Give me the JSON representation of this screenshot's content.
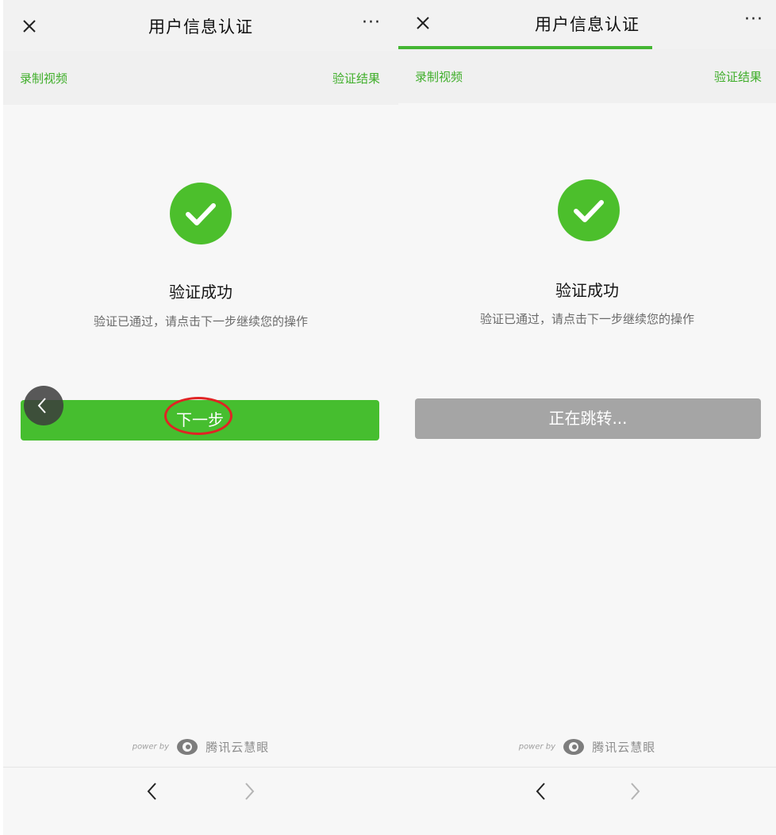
{
  "left": {
    "title": "用户信息认证",
    "more_label": "···",
    "tab_record": "录制视频",
    "tab_result": "验证结果",
    "success_title": "验证成功",
    "success_desc": "验证已通过，请点击下一步继续您的操作",
    "next_button": "下一步",
    "powered_by": "power by",
    "brand_name": "腾讯云慧眼"
  },
  "right": {
    "title": "用户信息认证",
    "more_label": "···",
    "tab_record": "录制视频",
    "tab_result": "验证结果",
    "success_title": "验证成功",
    "success_desc": "验证已通过，请点击下一步继续您的操作",
    "redirect_button": "正在跳转...",
    "powered_by": "power by",
    "brand_name": "腾讯云慧眼"
  },
  "colors": {
    "accent_green": "#46be2f",
    "disabled_gray": "#a5a5a5",
    "highlight_red": "#e02424"
  }
}
